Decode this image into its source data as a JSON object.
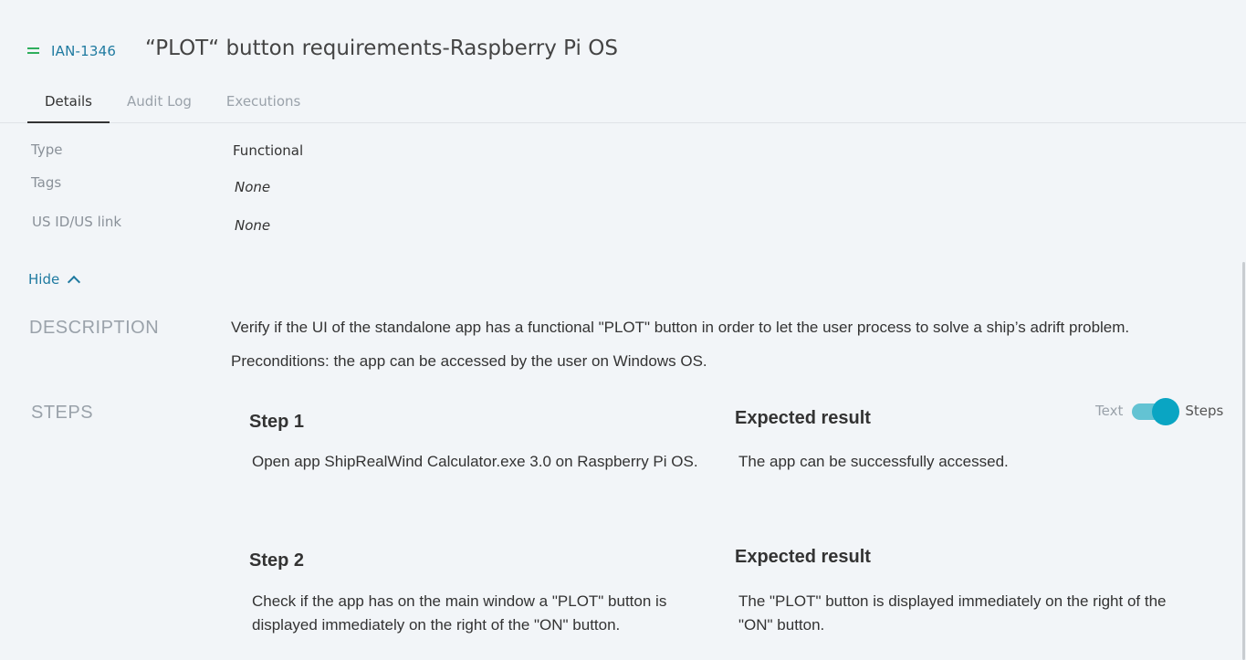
{
  "header": {
    "issue_key": "IAN-1346",
    "title": "“PLOT“ button requirements-Raspberry Pi OS",
    "priority_color": "#2fae5d"
  },
  "tabs": [
    {
      "label": "Details",
      "active": true
    },
    {
      "label": "Audit Log",
      "active": false
    },
    {
      "label": "Executions",
      "active": false
    }
  ],
  "details": {
    "type_label": "Type",
    "type_value": "Functional",
    "tags_label": "Tags",
    "tags_value": "None",
    "us_label": "US ID/US link",
    "us_value": "None"
  },
  "hide_label": "Hide",
  "description": {
    "heading": "DESCRIPTION",
    "text": "Verify if the UI of the standalone app has a functional \"PLOT\" button in order to let the user process to solve a ship’s adrift problem.",
    "preconditions": "Preconditions: the app can be accessed by the user on Windows OS."
  },
  "steps_section": {
    "heading": "STEPS",
    "toggle_text_label": "Text",
    "toggle_steps_label": "Steps",
    "toggle_on": true,
    "accent_color": "#0aa5c3"
  },
  "steps": [
    {
      "title": "Step 1",
      "action": "Open app ShipRealWind Calculator.exe 3.0 on Raspberry Pi OS.",
      "expected_title": "Expected result",
      "expected": "The app can be successfully accessed."
    },
    {
      "title": "Step 2",
      "action": "Check if the app has on the main window a \"PLOT\" button is displayed immediately on the right of the \"ON\" button.",
      "expected_title": "Expected result",
      "expected": "The \"PLOT\" button is displayed immediately on the right of the \"ON\" button."
    }
  ]
}
